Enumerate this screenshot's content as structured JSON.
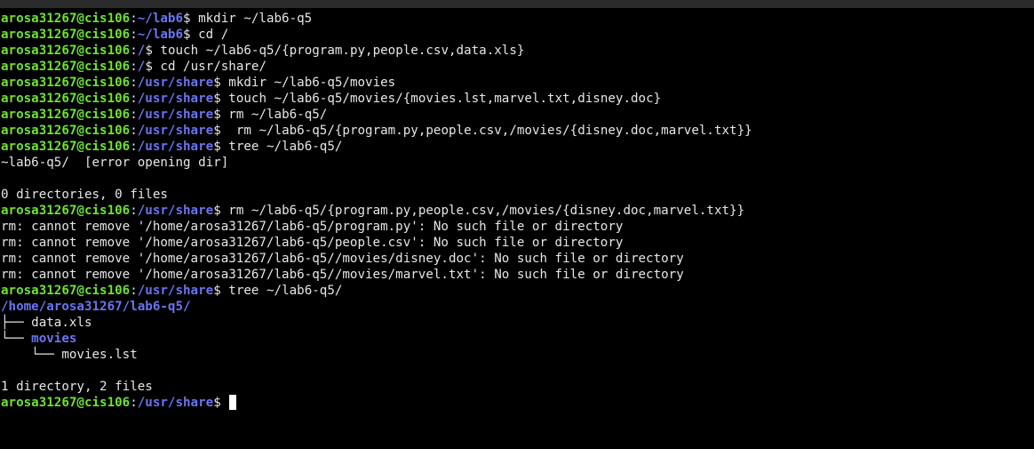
{
  "window": {
    "title": ""
  },
  "colors": {
    "background": "#000000",
    "user": "#6ee22f",
    "path": "#6b74ef",
    "text": "#e6e6e6"
  },
  "prompt": {
    "user": "arosa31267@cis106",
    "colon": ":",
    "dollar": "$"
  },
  "lines": [
    {
      "kind": "cmd",
      "path": "~/lab6",
      "cmd": " mkdir ~/lab6-q5"
    },
    {
      "kind": "cmd",
      "path": "~/lab6",
      "cmd": " cd /"
    },
    {
      "kind": "cmd",
      "path": "/",
      "cmd": " touch ~/lab6-q5/{program.py,people.csv,data.xls}"
    },
    {
      "kind": "cmd",
      "path": "/",
      "cmd": " cd /usr/share/"
    },
    {
      "kind": "cmd",
      "path": "/usr/share",
      "cmd": " mkdir ~/lab6-q5/movies"
    },
    {
      "kind": "cmd",
      "path": "/usr/share",
      "cmd": " touch ~/lab6-q5/movies/{movies.lst,marvel.txt,disney.doc}"
    },
    {
      "kind": "cmd",
      "path": "/usr/share",
      "cmd": " rm ~/lab6-q5/"
    },
    {
      "kind": "cmd",
      "path": "/usr/share",
      "cmd": "  rm ~/lab6-q5/{program.py,people.csv,/movies/{disney.doc,marvel.txt}}"
    },
    {
      "kind": "cmd",
      "path": "/usr/share",
      "cmd": " tree ~/lab6-q5/"
    },
    {
      "kind": "out",
      "text": "~lab6-q5/  [error opening dir]"
    },
    {
      "kind": "out",
      "text": ""
    },
    {
      "kind": "out",
      "text": "0 directories, 0 files"
    },
    {
      "kind": "cmd",
      "path": "/usr/share",
      "cmd": " rm ~/lab6-q5/{program.py,people.csv,/movies/{disney.doc,marvel.txt}}"
    },
    {
      "kind": "out",
      "text": "rm: cannot remove '/home/arosa31267/lab6-q5/program.py': No such file or directory"
    },
    {
      "kind": "out",
      "text": "rm: cannot remove '/home/arosa31267/lab6-q5/people.csv': No such file or directory"
    },
    {
      "kind": "out",
      "text": "rm: cannot remove '/home/arosa31267/lab6-q5//movies/disney.doc': No such file or directory"
    },
    {
      "kind": "out",
      "text": "rm: cannot remove '/home/arosa31267/lab6-q5//movies/marvel.txt': No such file or directory"
    },
    {
      "kind": "cmd",
      "path": "/usr/share",
      "cmd": " tree ~/lab6-q5/"
    },
    {
      "kind": "dir",
      "text": "/home/arosa31267/lab6-q5/"
    },
    {
      "kind": "tree",
      "prefix": "├── ",
      "text": "data.xls",
      "isDir": false
    },
    {
      "kind": "tree",
      "prefix": "└── ",
      "text": "movies",
      "isDir": true
    },
    {
      "kind": "tree",
      "prefix": "    └── ",
      "text": "movies.lst",
      "isDir": false
    },
    {
      "kind": "out",
      "text": ""
    },
    {
      "kind": "out",
      "text": "1 directory, 2 files"
    },
    {
      "kind": "prompt",
      "path": "/usr/share",
      "cmd": " "
    }
  ]
}
